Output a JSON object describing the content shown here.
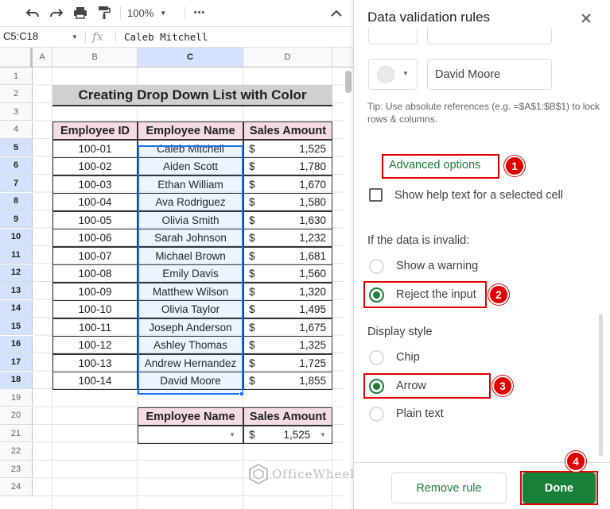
{
  "toolbar": {
    "zoom": "100%",
    "more": "•••"
  },
  "formula_bar": {
    "name_box": "C5:C18",
    "fx": "fx",
    "value": "Caleb Mitchell"
  },
  "columns": [
    "A",
    "B",
    "C",
    "D"
  ],
  "rows": [
    "1",
    "2",
    "3",
    "4",
    "5",
    "6",
    "7",
    "8",
    "9",
    "10",
    "11",
    "12",
    "13",
    "14",
    "15",
    "16",
    "17",
    "18",
    "19",
    "20",
    "21",
    "22",
    "23",
    "24"
  ],
  "sheet": {
    "title": "Creating Drop Down List with Color",
    "headers": [
      "Employee ID",
      "Employee Name",
      "Sales Amount"
    ],
    "records": [
      [
        "100-01",
        "Caleb Mitchell",
        "$",
        "1,525"
      ],
      [
        "100-02",
        "Aiden Scott",
        "$",
        "1,780"
      ],
      [
        "100-03",
        "Ethan William",
        "$",
        "1,670"
      ],
      [
        "100-04",
        "Ava Rodriguez",
        "$",
        "1,580"
      ],
      [
        "100-05",
        "Olivia Smith",
        "$",
        "1,630"
      ],
      [
        "100-06",
        "Sarah Johnson",
        "$",
        "1,232"
      ],
      [
        "100-07",
        "Michael Brown",
        "$",
        "1,681"
      ],
      [
        "100-08",
        "Emily Davis",
        "$",
        "1,560"
      ],
      [
        "100-09",
        "Matthew Wilson",
        "$",
        "1,320"
      ],
      [
        "100-10",
        "Olivia Taylor",
        "$",
        "1,495"
      ],
      [
        "100-11",
        "Joseph Anderson",
        "$",
        "1,675"
      ],
      [
        "100-12",
        "Ashley Thomas",
        "$",
        "1,325"
      ],
      [
        "100-13",
        "Andrew Hernandez",
        "$",
        "1,725"
      ],
      [
        "100-14",
        "David Moore",
        "$",
        "1,855"
      ]
    ],
    "lookup_headers": [
      "Employee Name",
      "Sales Amount"
    ],
    "lookup_values": [
      "",
      "$",
      "1,525"
    ]
  },
  "watermark": "OfficeWheel",
  "panel": {
    "title": "Data validation rules",
    "item_value": "David Moore",
    "tip": "Tip: Use absolute references (e.g. =$A$1:$B$1) to lock rows & columns.",
    "advanced_options": "Advanced options",
    "help_text_label": "Show help text for a selected cell",
    "invalid_label": "If the data is invalid:",
    "invalid_options": [
      "Show a warning",
      "Reject the input"
    ],
    "display_style_label": "Display style",
    "display_options": [
      "Chip",
      "Arrow",
      "Plain text"
    ],
    "remove_rule": "Remove rule",
    "done": "Done",
    "markers": [
      "1",
      "2",
      "3",
      "4"
    ]
  }
}
